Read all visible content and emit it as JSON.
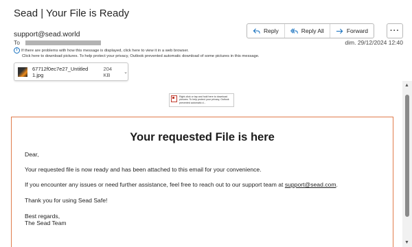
{
  "email": {
    "subject": "Sead | Your File is Ready",
    "sender": "support@sead.world",
    "to_label": "To",
    "date": "dim. 29/12/2024 12:40",
    "info_line1": "If there are problems with how this message is displayed, click here to view it in a web browser.",
    "info_line2": "Click here to download pictures. To help protect your privacy, Outlook prevented automatic download of some pictures in this message."
  },
  "actions": {
    "reply": "Reply",
    "reply_all": "Reply All",
    "forward": "Forward",
    "more": "···"
  },
  "attachment": {
    "name": "67712f0ec7e27_Untitled 1.jpg",
    "size": "204 KB"
  },
  "blocked_image": {
    "text": "Right-click or tap and hold here to download pictures. To help protect your privacy, Outlook prevented automatic d..."
  },
  "body": {
    "heading": "Your requested File is here",
    "greeting": "Dear,",
    "para1": "Your requested file is now ready and has been attached to this email for your convenience.",
    "para2_prefix": "If you encounter any issues or need further assistance, feel free to reach out to our support team at ",
    "para2_link": "support@sead.com",
    "para2_suffix": ".",
    "para3": "Thank you for using Sead Safe!",
    "signoff1": "Best regards,",
    "signoff2": "The Sead Team"
  },
  "colors": {
    "accent": "#0f6cbd",
    "card_border": "#e07a4a"
  }
}
